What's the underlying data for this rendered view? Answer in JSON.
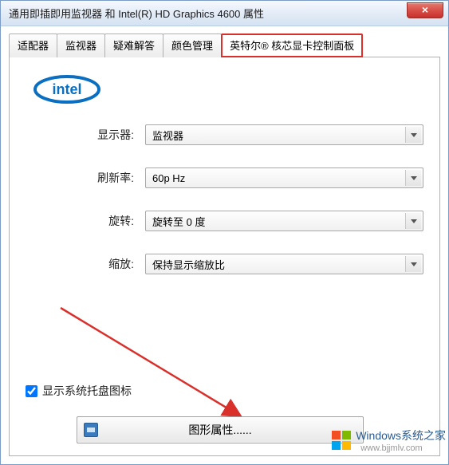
{
  "window": {
    "title": "通用即插即用监视器 和 Intel(R) HD Graphics 4600 属性",
    "close_label": "×"
  },
  "tabs": [
    {
      "label": "适配器"
    },
    {
      "label": "监视器"
    },
    {
      "label": "疑难解答"
    },
    {
      "label": "颜色管理"
    },
    {
      "label": "英特尔® 核芯显卡控制面板",
      "active": true,
      "highlighted": true
    }
  ],
  "logo": {
    "text": "intel"
  },
  "form": {
    "display": {
      "label": "显示器:",
      "value": "监视器"
    },
    "refresh": {
      "label": "刷新率:",
      "value": "60p Hz"
    },
    "rotation": {
      "label": "旋转:",
      "value": "旋转至 0 度"
    },
    "scaling": {
      "label": "缩放:",
      "value": "保持显示缩放比"
    }
  },
  "tray_checkbox": {
    "label": "显示系统托盘图标",
    "checked": true
  },
  "graphics_button": {
    "label": "图形属性......"
  },
  "watermark": {
    "text": "Windows系统之家",
    "domain": "www.bjjmlv.com"
  }
}
